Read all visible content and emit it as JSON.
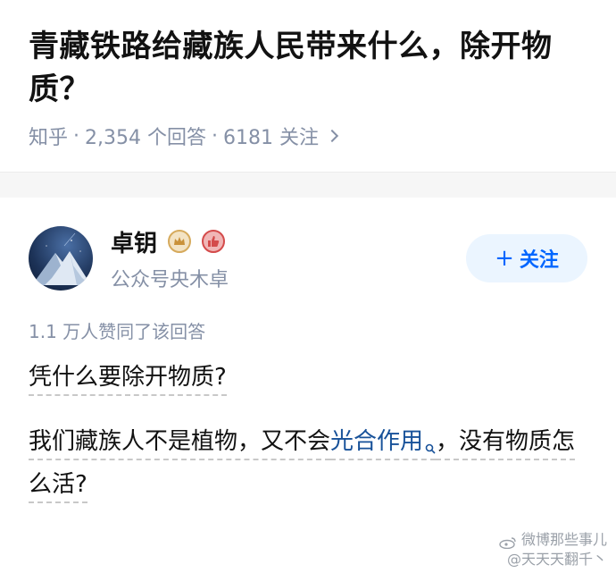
{
  "question": {
    "title": "青藏铁路给藏族人民带来什么，除开物质？",
    "source": "知乎",
    "answers_count": "2,354 个回答",
    "followers_count": "6181 关注",
    "separator": "·"
  },
  "author": {
    "name": "卓钥",
    "description": "公众号央木卓",
    "follow_label": "关注",
    "follow_prefix": "+"
  },
  "answer": {
    "upvotes": "1.1 万人赞同了该回答",
    "paragraph1": "凭什么要除开物质?",
    "paragraph2_before": "我们藏族人不是植物，又不会",
    "paragraph2_link": "光合作用",
    "paragraph2_after": "，没有物质怎么活?"
  },
  "watermark": {
    "line1": "微博那些事儿",
    "line2": "@天天天翻千丶"
  },
  "colors": {
    "accent": "#0066ff",
    "meta_gray": "#8590a6",
    "link": "#175199"
  }
}
